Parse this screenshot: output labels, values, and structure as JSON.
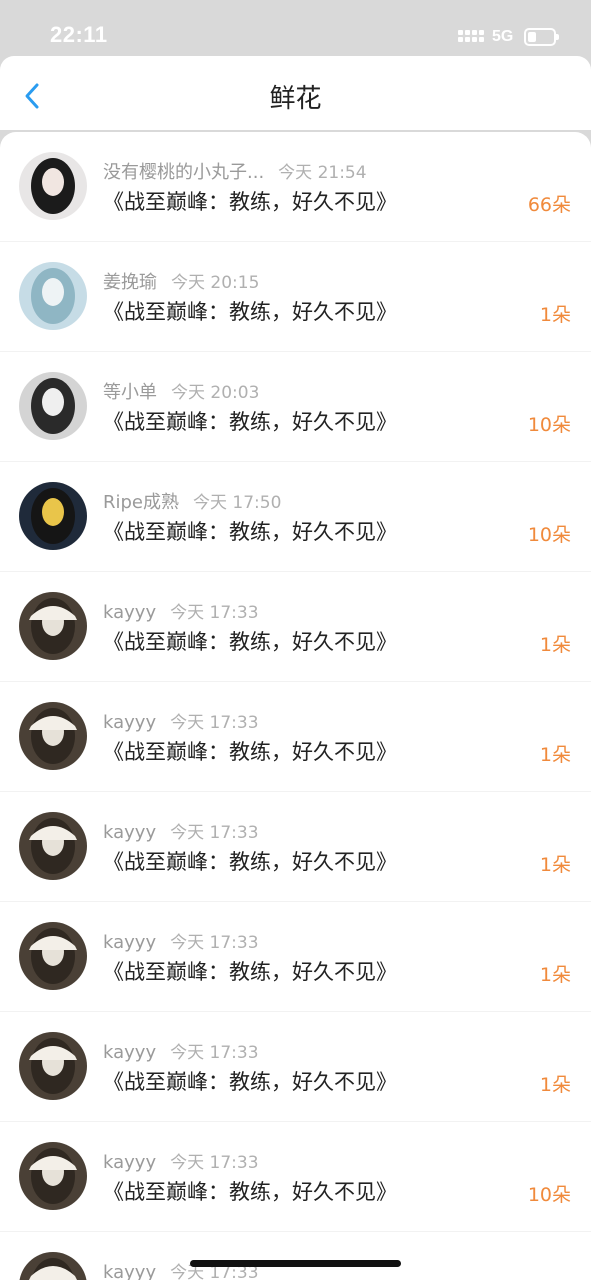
{
  "status": {
    "time": "22:11",
    "network": "5G"
  },
  "header": {
    "title": "鲜花",
    "back_icon": "chevron-left-icon"
  },
  "colors": {
    "accent": "#f08a3c",
    "back": "#2a9cf0"
  },
  "items": [
    {
      "name": "没有樱桃的小丸子...",
      "time": "今天 21:54",
      "title": "《战至巅峰：教练，好久不见》",
      "count": "66朵",
      "avatar": "dark"
    },
    {
      "name": "姜挽瑜",
      "time": "今天 20:15",
      "title": "《战至巅峰：教练，好久不见》",
      "count": "1朵",
      "avatar": "blue"
    },
    {
      "name": "等小单",
      "time": "今天 20:03",
      "title": "《战至巅峰：教练，好久不见》",
      "count": "10朵",
      "avatar": "gray"
    },
    {
      "name": "Ripe成熟",
      "time": "今天 17:50",
      "title": "《战至巅峰：教练，好久不见》",
      "count": "10朵",
      "avatar": "yellow"
    },
    {
      "name": "kayyy",
      "time": "今天 17:33",
      "title": "《战至巅峰：教练，好久不见》",
      "count": "1朵",
      "avatar": "cap"
    },
    {
      "name": "kayyy",
      "time": "今天 17:33",
      "title": "《战至巅峰：教练，好久不见》",
      "count": "1朵",
      "avatar": "cap"
    },
    {
      "name": "kayyy",
      "time": "今天 17:33",
      "title": "《战至巅峰：教练，好久不见》",
      "count": "1朵",
      "avatar": "cap"
    },
    {
      "name": "kayyy",
      "time": "今天 17:33",
      "title": "《战至巅峰：教练，好久不见》",
      "count": "1朵",
      "avatar": "cap"
    },
    {
      "name": "kayyy",
      "time": "今天 17:33",
      "title": "《战至巅峰：教练，好久不见》",
      "count": "1朵",
      "avatar": "cap"
    },
    {
      "name": "kayyy",
      "time": "今天 17:33",
      "title": "《战至巅峰：教练，好久不见》",
      "count": "10朵",
      "avatar": "cap"
    },
    {
      "name": "kayyy",
      "time": "今天 17:33",
      "title": "",
      "count": "",
      "avatar": "cap"
    }
  ]
}
